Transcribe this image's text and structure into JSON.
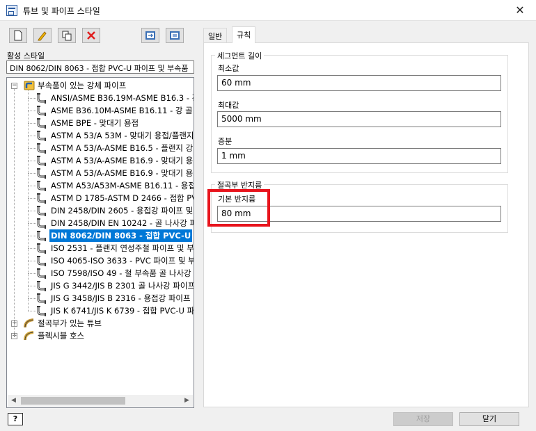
{
  "window": {
    "title": "튜브 및 파이프 스타일",
    "close_glyph": "✕"
  },
  "toolbar": {
    "buttons": [
      {
        "name": "new-style-button",
        "icon": "new-document-icon"
      },
      {
        "name": "edit-style-button",
        "icon": "pencil-icon"
      },
      {
        "name": "copy-style-button",
        "icon": "copy-icon"
      },
      {
        "name": "delete-style-button",
        "icon": "red-x-icon",
        "color": "#e02020"
      },
      {
        "name": "import-button",
        "icon": "import-icon"
      },
      {
        "name": "export-button",
        "icon": "export-icon"
      }
    ]
  },
  "active_style": {
    "label": "활성 스타일",
    "value": "DIN 8062/DIN 8063 - 접합 PVC-U 파이프 및 부속품"
  },
  "tree": {
    "groups": [
      {
        "label": "부속품이 있는 강체 파이프",
        "expanded": true,
        "items": [
          "ANSI/ASME B36.19M-ASME B16.3 - 강",
          "ASME B36.10M-ASME B16.11 - 강 골",
          "ASME BPE - 맞대기 용접",
          "ASTM A 53/A 53M - 맞대기 용접/플랜지",
          "ASTM A 53/A-ASME B16.5 - 플랜지 강",
          "ASTM A 53/A-ASME B16.9 - 맞대기 용",
          "ASTM A 53/A-ASME B16.9 - 맞대기 용",
          "ASTM A53/A53M-ASME B16.11 - 용접",
          "ASTM D 1785-ASTM D 2466 - 접합 PV",
          "DIN 2458/DIN 2605 - 용접강 파이프 및",
          "DIN 2458/DIN EN 10242 - 골 나사강 파",
          "DIN 8062/DIN 8063 - 접합 PVC-U",
          "ISO 2531 - 플랜지 연성주철 파이프 및 부",
          "ISO 4065-ISO 3633 - PVC 파이프 및 부",
          "ISO 7598/ISO 49 - 철 부속품 골 나사강",
          "JIS G 3442/JIS B 2301 골 나사강 파이프",
          "JIS G 3458/JIS B 2316 - 용접강 파이프",
          "JIS K 6741/JIS K 6739 - 접합 PVC-U 파"
        ],
        "selected_index": 11
      },
      {
        "label": "절곡부가 있는 튜브",
        "expanded": false
      },
      {
        "label": "플렉시블 호스",
        "expanded": false
      }
    ],
    "scroll_left": "◀",
    "scroll_right": "▶"
  },
  "tabs": [
    {
      "label": "일반",
      "active": false
    },
    {
      "label": "규칙",
      "active": true
    }
  ],
  "segment_length": {
    "title": "세그먼트 길이",
    "min_label": "최소값",
    "min_value": "60 mm",
    "max_label": "최대값",
    "max_value": "5000 mm",
    "inc_label": "증분",
    "inc_value": "1 mm"
  },
  "bend_radius": {
    "title": "절곡부 반지름",
    "default_label": "기본 반지름",
    "default_value": "80 mm"
  },
  "highlight_color": "#e8141d",
  "footer": {
    "help_label": "?",
    "save_label": "저장",
    "close_label": "닫기"
  }
}
